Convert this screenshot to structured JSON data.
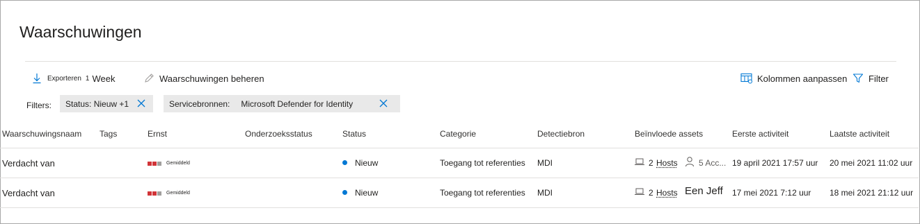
{
  "page": {
    "title": "Waarschuwingen"
  },
  "toolbar": {
    "export_label": "Exporteren",
    "export_count": "1",
    "period_label": "Week",
    "manage_label": "Waarschuwingen beheren",
    "columns_label": "Kolommen aanpassen",
    "filter_label": "Filter"
  },
  "filters": {
    "label": "Filters:",
    "status_pill": "Status: Nieuw +1",
    "source_key": "Servicebronnen:",
    "source_value": "Microsoft Defender for Identity"
  },
  "table": {
    "columns": [
      "Waarschuwingsnaam",
      "Tags",
      "Ernst",
      "Onderzoeksstatus",
      "Status",
      "Categorie",
      "Detectiebron",
      "Beïnvloede assets",
      "Eerste activiteit",
      "Laatste activiteit"
    ],
    "rows": [
      {
        "name": "Verdacht van",
        "severity": "Gemiddeld",
        "status": "Nieuw",
        "category": "Toegang tot referenties",
        "source": "MDI",
        "hosts_count": "2",
        "hosts_label": "Hosts",
        "accounts": "5 Acc...",
        "first": "19 april 2021 17:57 uur",
        "last": "20 mei 2021 11:02 uur"
      },
      {
        "name": "Verdacht van",
        "severity": "Gemiddeld",
        "status": "Nieuw",
        "category": "Toegang tot referenties",
        "source": "MDI",
        "hosts_count": "2",
        "hosts_label": "Hosts",
        "accounts": "Een Jeff",
        "first": "17 mei 2021 7:12 uur",
        "last": "18 mei 2021 21:12 uur"
      }
    ]
  },
  "colors": {
    "accent": "#0078d4",
    "severity_on": "#d13438",
    "severity_off": "#a19f9d",
    "pill_bg": "#e9e9e9",
    "status_new": "#0078d4"
  },
  "icons": [
    "download-icon",
    "pencil-icon",
    "columns-settings-icon",
    "filter-icon",
    "close-icon",
    "laptop-icon",
    "person-icon"
  ]
}
